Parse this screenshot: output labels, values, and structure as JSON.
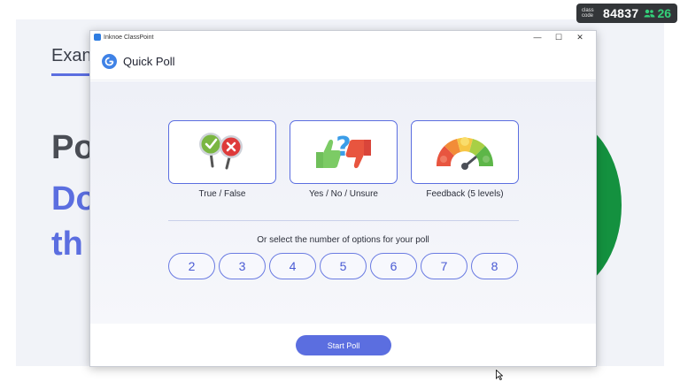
{
  "slide": {
    "title": "Exan",
    "big1": "Po",
    "big2": "Do",
    "big3": "th"
  },
  "class_code": {
    "label_line1": "class",
    "label_line2": "code",
    "code": "84837",
    "users": "26",
    "users_icon": "users-icon"
  },
  "window": {
    "app_title": "Inknoe ClassPoint",
    "minimize": "—",
    "maximize": "☐",
    "close": "✕"
  },
  "dialog": {
    "title": "Quick Poll",
    "options": [
      {
        "label": "True / False",
        "icon": "true-false-icon"
      },
      {
        "label": "Yes / No / Unsure",
        "icon": "yes-no-unsure-icon"
      },
      {
        "label": "Feedback (5 levels)",
        "icon": "feedback-gauge-icon"
      }
    ],
    "select_prompt": "Or select the number of options for your poll",
    "numbers": [
      "2",
      "3",
      "4",
      "5",
      "6",
      "7",
      "8"
    ],
    "start_button": "Start Poll"
  },
  "colors": {
    "accent": "#5b6ee0",
    "green": "#14913f",
    "badge_bg": "#333639"
  }
}
